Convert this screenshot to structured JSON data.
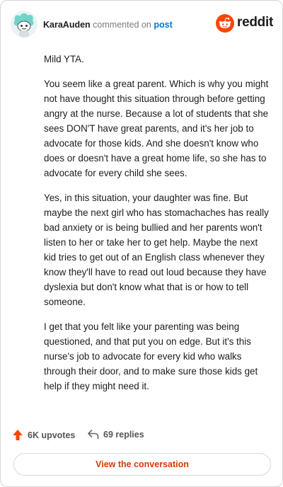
{
  "header": {
    "username": "KaraAuden",
    "action_text": "commented on",
    "post_link": "post",
    "brand": "reddit"
  },
  "comment": {
    "paragraphs": [
      "Mild YTA.",
      "You seem like a great parent. Which is why you might not have thought this situation through before getting angry at the nurse. Because a lot of students that she sees DON'T have great parents, and it's her job to advocate for those kids. And she doesn't know who does or doesn't have a great home life, so she has to advocate for every child she sees.",
      "Yes, in this situation, your daughter was fine. But maybe the next girl who has stomachaches has really bad anxiety or is being bullied and her parents won't listen to her or take her to get help. Maybe the next kid tries to get out of an English class whenever they know they'll have to read out loud because they have dyslexia but don't know what that is or how to tell someone.",
      "I get that you felt like your parenting was being questioned, and that put you on edge. But it's this nurse's job to advocate for every kid who walks through their door, and to make sure those kids get help if they might need it."
    ]
  },
  "footer": {
    "upvotes": "6K upvotes",
    "replies": "69 replies",
    "view_button": "View the conversation"
  },
  "icons": {
    "avatar": "snoo-avatar-icon",
    "brand": "reddit-snoo-icon",
    "upvote": "upvote-arrow-icon",
    "reply": "reply-arrow-icon"
  },
  "colors": {
    "brand_orange": "#ff4500",
    "upvote_orange": "#ff4500",
    "link_blue": "#0079d3",
    "button_text": "#d93a00"
  }
}
